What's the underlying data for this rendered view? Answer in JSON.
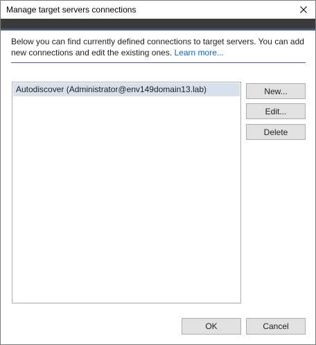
{
  "window": {
    "title": "Manage target servers connections",
    "close_label": "close"
  },
  "description": {
    "text": "Below you can find currently defined connections to target servers. You can add new connections and edit the existing ones.",
    "link": "Learn more..."
  },
  "connections": {
    "items": [
      {
        "label": "Autodiscover (Administrator@env149domain13.lab)",
        "selected": true
      }
    ]
  },
  "side_buttons": {
    "new_label": "New...",
    "edit_label": "Edit...",
    "delete_label": "Delete"
  },
  "footer_buttons": {
    "ok_label": "OK",
    "cancel_label": "Cancel"
  },
  "colors": {
    "header_dark": "#3a3a3a",
    "accent": "#4a5a78",
    "link": "#0a64b4",
    "selection": "#d8e0ec"
  }
}
